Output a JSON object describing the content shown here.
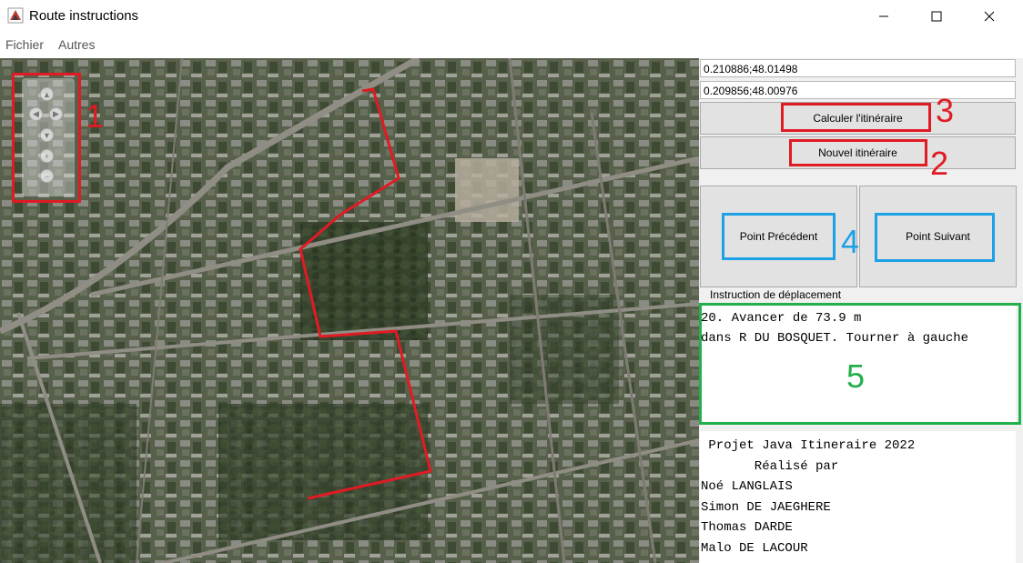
{
  "window": {
    "title": "Route instructions",
    "app_icon": "java-icon"
  },
  "menu": {
    "items": [
      "Fichier",
      "Autres"
    ]
  },
  "inputs": {
    "start": "0.210886;48.01498",
    "end": "0.209856;48.00976"
  },
  "buttons": {
    "compute": "Calculer l'itinéraire",
    "new_route": "Nouvel itinéraire",
    "previous": "Point Précédent",
    "next": "Point Suivant"
  },
  "instructions": {
    "label": "Instruction de déplacement",
    "line1": "20. Avancer de 73.9 m",
    "line2": "dans R DU BOSQUET. Tourner à gauche"
  },
  "credits": {
    "line1": " Projet Java Itineraire 2022",
    "line2": "       Réalisé par",
    "line3": "Noé LANGLAIS",
    "line4": "Simon DE JAEGHERE",
    "line5": "Thomas DARDE",
    "line6": "Malo DE LACOUR"
  },
  "annotations": {
    "n1": "1",
    "n2": "2",
    "n3": "3",
    "n4": "4",
    "n5": "5"
  },
  "colors": {
    "route": "#e01b24",
    "red_annotation": "#e01b24",
    "blue_annotation": "#1da1e6",
    "green_annotation": "#22b04c"
  }
}
